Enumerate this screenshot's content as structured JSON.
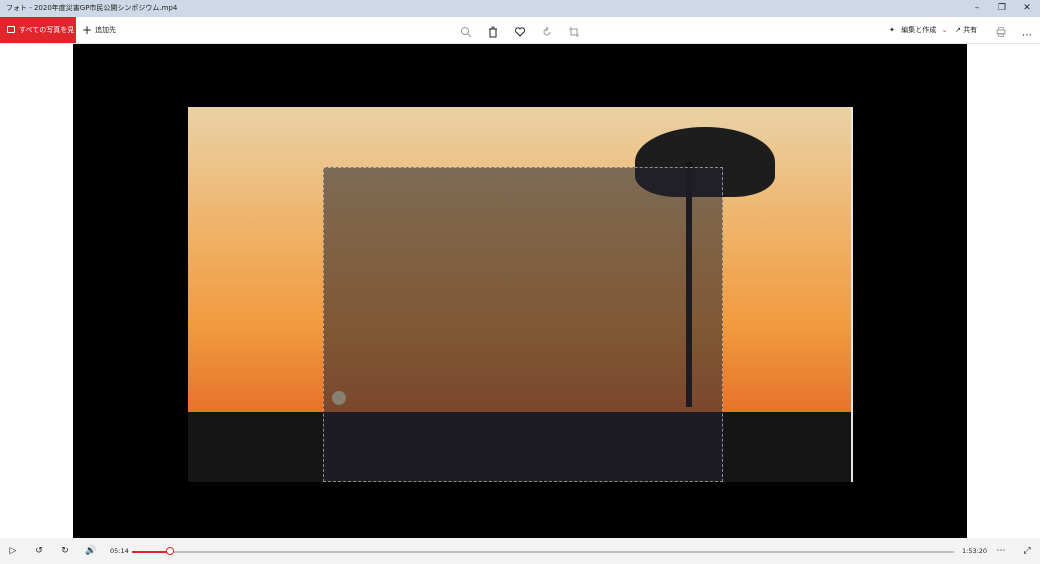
{
  "window": {
    "title": "フォト - 2020年度災害GP市民公開シンポジウム.mp4",
    "minimize_icon": "minimize-icon",
    "restore_icon": "restore-icon",
    "close_icon": "close-icon"
  },
  "toolbar": {
    "all_photos_label": "すべての写真を見る",
    "add_to_label": "追加先",
    "edit_create_label": "編集と作成",
    "share_label": "共有",
    "icons": [
      "zoom-icon",
      "delete-icon",
      "favorite-icon",
      "rotate-icon",
      "crop-icon",
      "print-icon",
      "more-icon"
    ]
  },
  "player": {
    "current_time": "05:14",
    "total_time": "1:53:20",
    "progress": 0.046
  },
  "colors": {
    "accent": "#e0262c",
    "titlebar": "#cfd8e6",
    "stage": "#000000"
  }
}
